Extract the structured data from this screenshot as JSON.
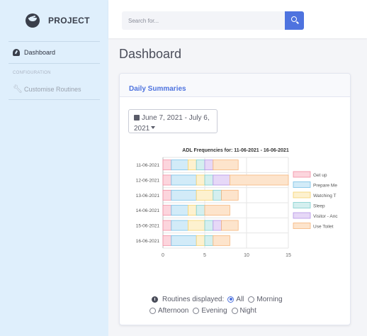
{
  "brand": {
    "name": "PROJECT"
  },
  "sidebar": {
    "items": [
      {
        "label": "Dashboard"
      }
    ],
    "heading": "CONFIGURATION",
    "config_items": [
      {
        "label": "Customise Routines"
      }
    ]
  },
  "search": {
    "placeholder": "Search for..."
  },
  "page": {
    "title": "Dashboard"
  },
  "card": {
    "title": "Daily Summaries",
    "date_range_line1": "June 7, 2021 - July 6,",
    "date_range_line2": "2021"
  },
  "routines": {
    "label": "Routines displayed:",
    "options": [
      "All",
      "Morning",
      "Afternoon",
      "Evening",
      "Night"
    ],
    "selected": "All"
  },
  "colors": {
    "accent": "#4e73df",
    "sidebar_bg": "#dfeffc"
  },
  "chart_data": {
    "type": "bar",
    "orientation": "horizontal",
    "stacked": true,
    "title": "ADL Frequencies for: 11-06-2021 - 16-06-2021",
    "categories": [
      "11-06-2021",
      "12-06-2021",
      "13-06-2021",
      "14-06-2021",
      "15-06-2021",
      "16-06-2021"
    ],
    "series": [
      {
        "name": "Get up",
        "values": [
          1,
          1,
          1,
          1,
          1,
          1
        ],
        "fill": "#fcd5dd",
        "stroke": "#f28ea3"
      },
      {
        "name": "Prepare Me",
        "values": [
          2,
          3,
          3,
          2,
          2,
          3
        ],
        "fill": "#d2ebf8",
        "stroke": "#78c0e6"
      },
      {
        "name": "Watching T",
        "values": [
          1,
          1,
          2,
          1,
          2,
          1
        ],
        "fill": "#fdf1cf",
        "stroke": "#f5d36f"
      },
      {
        "name": "Sleep",
        "values": [
          1,
          1,
          1,
          1,
          1,
          1
        ],
        "fill": "#d4efef",
        "stroke": "#7fcfcf"
      },
      {
        "name": "Visitor - Anc",
        "values": [
          1,
          2,
          0,
          0,
          1,
          0
        ],
        "fill": "#e6d8f7",
        "stroke": "#b494e6"
      },
      {
        "name": "Use Toilet",
        "values": [
          3,
          7,
          2,
          3,
          2,
          2
        ],
        "fill": "#fde4cc",
        "stroke": "#f6b57b"
      }
    ],
    "xlim": [
      0,
      15
    ],
    "xticks": [
      0,
      5,
      10,
      15
    ],
    "grid": true,
    "legend": "right"
  }
}
